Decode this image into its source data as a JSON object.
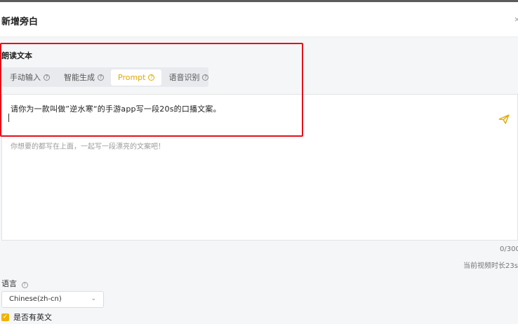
{
  "header": {
    "title": "新增旁白",
    "close_glyph": "×"
  },
  "reading_section": {
    "label": "朗读文本"
  },
  "tabs": [
    {
      "label": "手动输入",
      "active": false
    },
    {
      "label": "智能生成",
      "active": false
    },
    {
      "label": "Prompt",
      "active": true
    },
    {
      "label": "语音识别",
      "active": false
    }
  ],
  "help_glyph": "?",
  "prompt": {
    "value": "请你为一款叫做”逆水寒“的手游app写一段20s的口播文案。",
    "send_icon": "send-icon"
  },
  "textarea": {
    "placeholder": "你想要的都写在上面，一起写一段漂亮的文案吧！"
  },
  "counter": "0/300",
  "duration_text": "当前视频时长23s",
  "language": {
    "label": "语言",
    "selected": "Chinese(zh-cn)",
    "chevron": "⌄"
  },
  "english_checkbox": {
    "label": "是否有英文",
    "checked": true,
    "mark": "✓"
  },
  "colors": {
    "accent": "#e0a800",
    "highlight_frame": "#e5101a",
    "checkbox": "#f0b400"
  }
}
